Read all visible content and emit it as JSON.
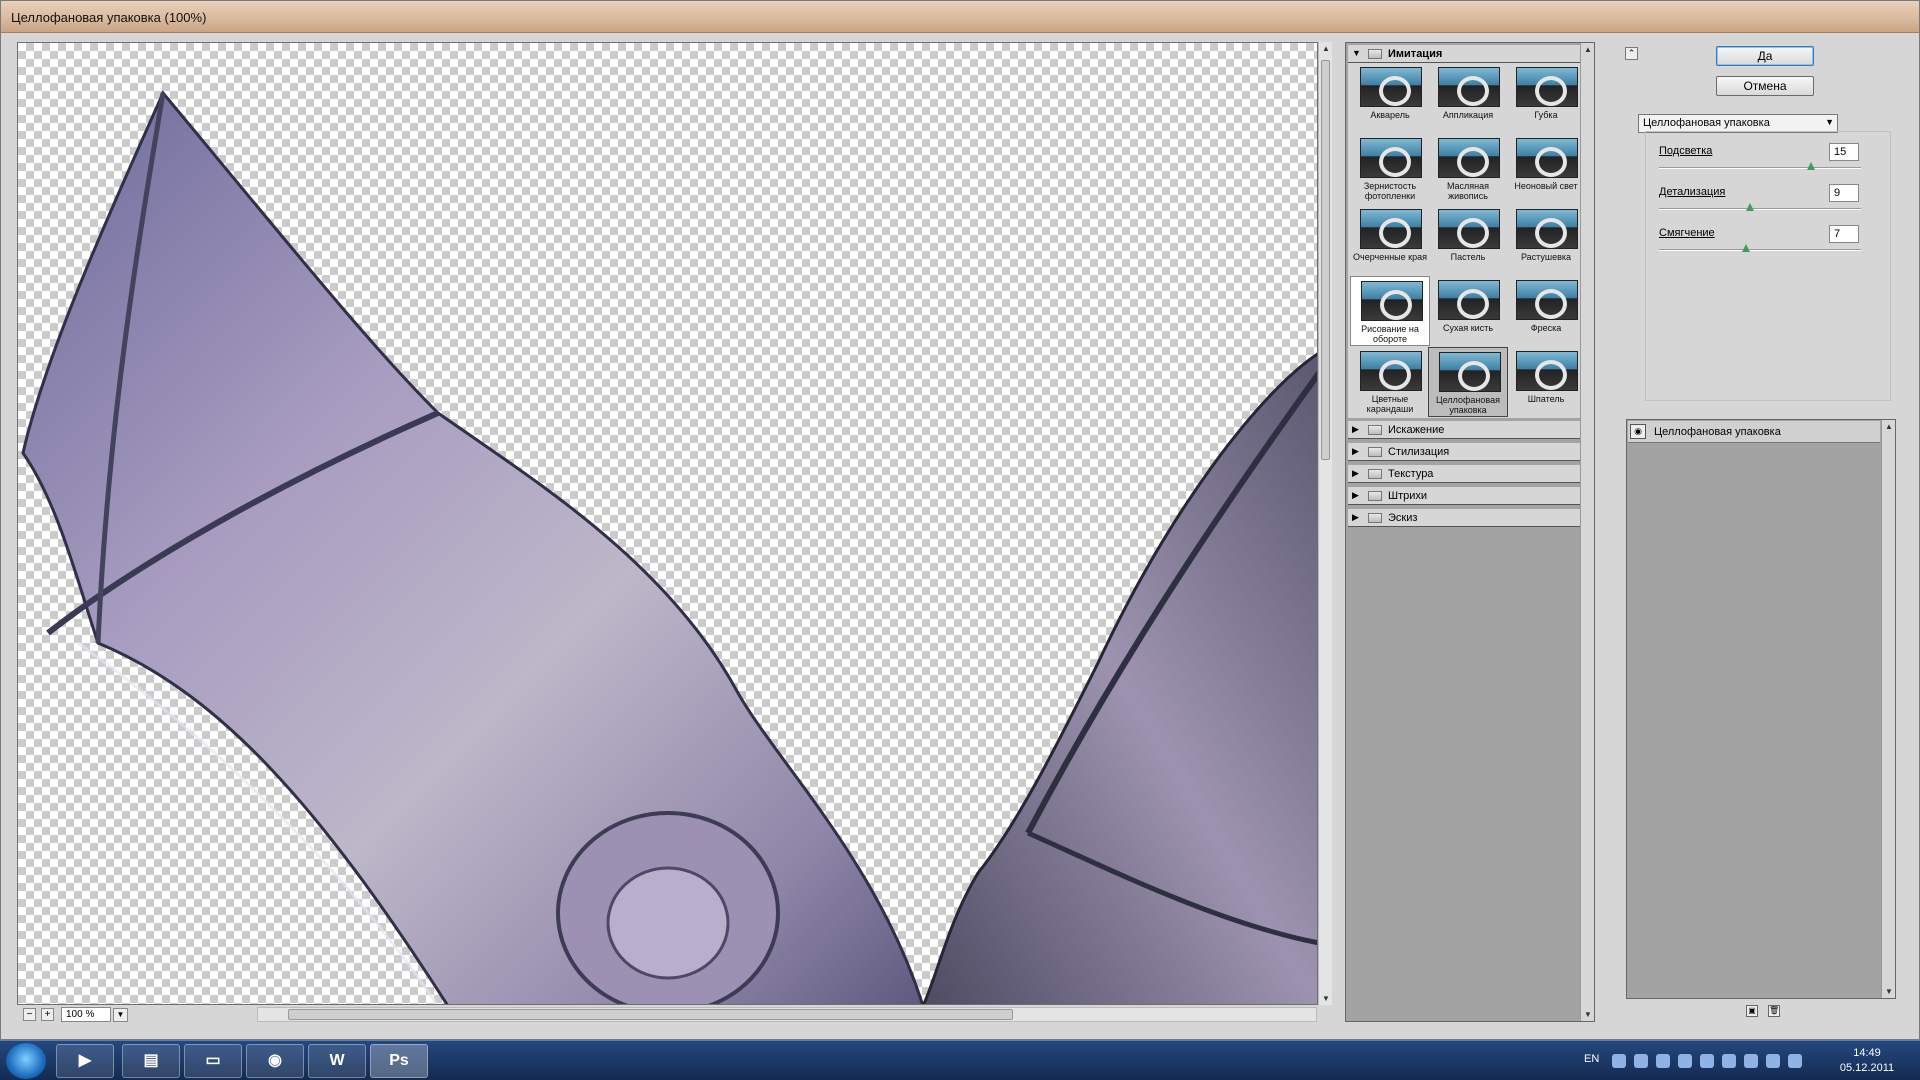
{
  "window": {
    "title": "Целлофановая упаковка (100%)"
  },
  "preview": {
    "zoom": "100 %",
    "zoom_out": "−",
    "zoom_in": "+"
  },
  "gallery": {
    "open_folder": "Имитация",
    "thumbnails": [
      "Акварель",
      "Аппликация",
      "Губка",
      "Зернистость фотопленки",
      "Масляная живопись",
      "Неоновый свет",
      "Очерченные края",
      "Пастель",
      "Растушевка",
      "Рисование на обороте",
      "Сухая кисть",
      "Фреска",
      "Цветные карандаши",
      "Целлофановая упаковка",
      "Шпатель"
    ],
    "selected": "Целлофановая упаковка",
    "folders": [
      "Искажение",
      "Стилизация",
      "Текстура",
      "Штрихи",
      "Эскиз"
    ]
  },
  "settings": {
    "ok_label": "Да",
    "cancel_label": "Отмена",
    "filter_select": "Целлофановая упаковка",
    "params": [
      {
        "label": "Подсветка",
        "value": "15",
        "level": 0.75
      },
      {
        "label": "Детализация",
        "value": "9",
        "level": 0.45
      },
      {
        "label": "Смягчение",
        "value": "7",
        "level": 0.43
      }
    ]
  },
  "layers": {
    "items": [
      "Целлофановая упаковка"
    ]
  },
  "taskbar": {
    "apps": [
      "media-player-icon",
      "explorer-icon",
      "cmd-icon",
      "chrome-icon",
      "word-icon",
      "photoshop-icon"
    ],
    "word_label": "W",
    "ps_label": "Ps",
    "lang": "EN",
    "time": "14:49",
    "date": "05.12.2011"
  }
}
